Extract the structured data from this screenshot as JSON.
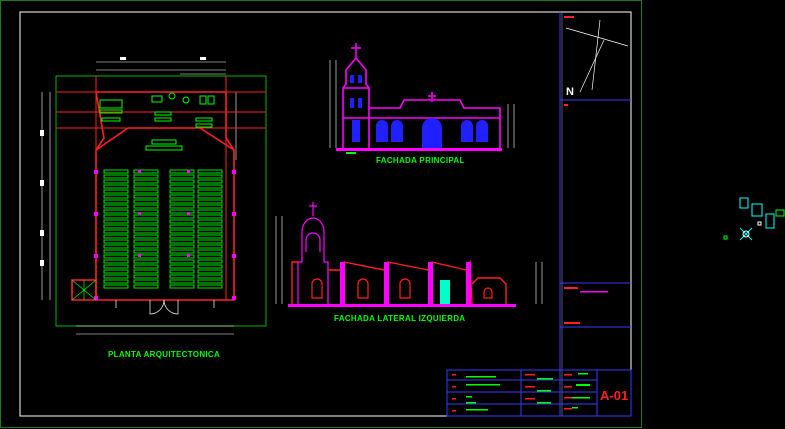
{
  "drawing": {
    "labels": {
      "plan_title": "PLANTA ARQUITECTONICA",
      "front_facade": "FACHADA PRINCIPAL",
      "side_facade": "FACHADA LATERAL IZQUIERDA"
    },
    "north_symbol": "N",
    "sheet_number": "A-01",
    "colors": {
      "background": "#000000",
      "frame": "#ffffff",
      "titleblock_lines": "#3a3aff",
      "walls": "#ff2020",
      "facade_trim": "#ff00ff",
      "openings": "#2020ff",
      "furniture": "#00ff00",
      "dimension": "#ffffff",
      "label_text": "#00ff00",
      "sheet_text": "#ff2020",
      "accent": "#00ffff"
    }
  }
}
